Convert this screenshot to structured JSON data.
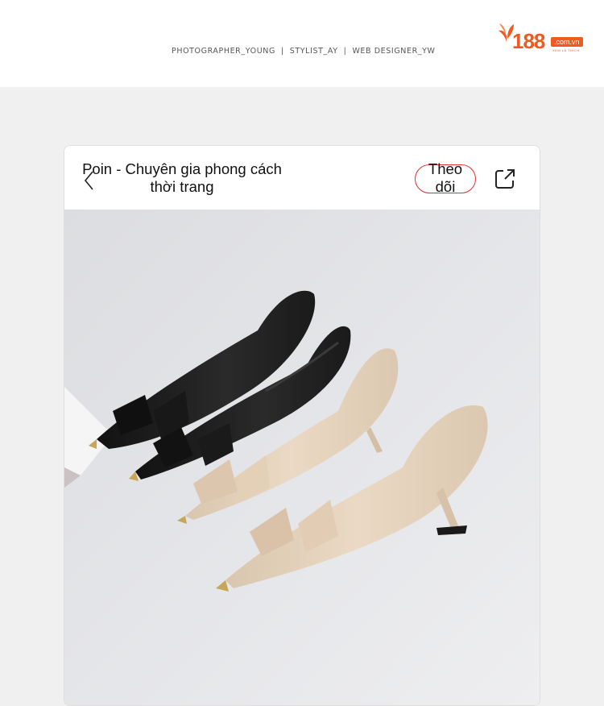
{
  "header": {
    "credits": [
      "PHOTOGRAPHER_YOUNG",
      "STYLIST_AY",
      "WEB  DESIGNER_YW"
    ],
    "separators": [
      "|",
      "|"
    ],
    "logo": {
      "number": "188",
      "domain": ".com.vn",
      "tagline": "XEM LÀ THÍCH"
    }
  },
  "card": {
    "title": "Poin - Chuyên gia phong cách thời trang",
    "follow_label": "Theo dõi",
    "icons": {
      "back": "chevron-left-icon",
      "share": "share-icon"
    }
  },
  "colors": {
    "brand": "#f05a1f",
    "follow_outline": "#e03030"
  }
}
